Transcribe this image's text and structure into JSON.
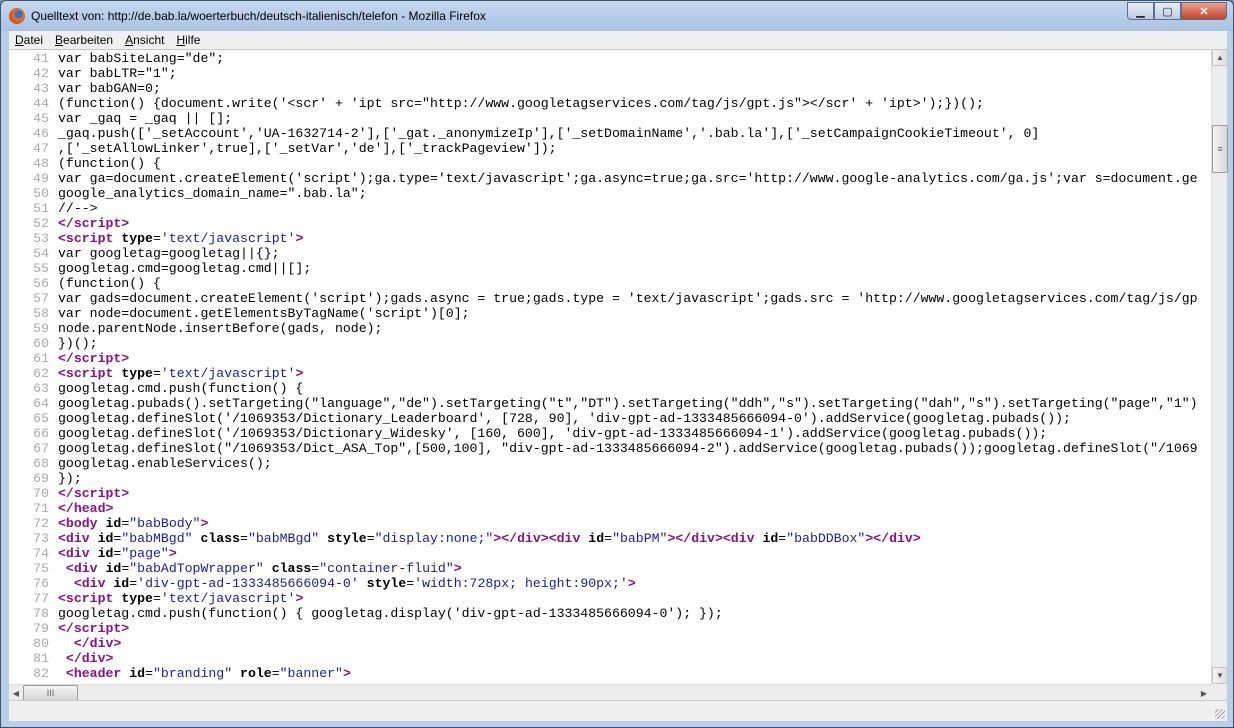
{
  "window": {
    "title": "Quelltext von: http://de.bab.la/woerterbuch/deutsch-italienisch/telefon - Mozilla Firefox",
    "controls": {
      "minimize": "▁",
      "maximize": "▢",
      "close": "✕"
    }
  },
  "menu": [
    "Datei",
    "Bearbeiten",
    "Ansicht",
    "Hilfe"
  ],
  "scroll": {
    "up": "▲",
    "down": "▼",
    "left": "◀",
    "right": "▶",
    "grip": "≡",
    "hgrip": "III"
  },
  "source": {
    "first_line": 41,
    "lines": [
      [
        [
          "x",
          "var babSiteLang=\"de\";"
        ]
      ],
      [
        [
          "x",
          "var babLTR=\"1\";"
        ]
      ],
      [
        [
          "x",
          "var babGAN=0;"
        ]
      ],
      [
        [
          "x",
          "(function() {document.write('<scr' + 'ipt src=\"http://www.googletagservices.com/tag/js/gpt.js\"></scr' + 'ipt>');})();"
        ]
      ],
      [
        [
          "x",
          "var _gaq = _gaq || [];"
        ]
      ],
      [
        [
          "x",
          "_gaq.push(['_setAccount','UA-1632714-2'],['_gat._anonymizeIp'],['_setDomainName','.bab.la'],['_setCampaignCookieTimeout', 0]"
        ]
      ],
      [
        [
          "x",
          ",['_setAllowLinker',true],['_setVar','de'],['_trackPageview']);"
        ]
      ],
      [
        [
          "x",
          "(function() {"
        ]
      ],
      [
        [
          "x",
          "var ga=document.createElement('script');ga.type='text/javascript';ga.async=true;ga.src='http://www.google-analytics.com/ga.js';var s=document.ge"
        ]
      ],
      [
        [
          "x",
          "google_analytics_domain_name=\".bab.la\";"
        ]
      ],
      [
        [
          "x",
          "//-->"
        ]
      ],
      [
        [
          "g",
          "</script>"
        ]
      ],
      [
        [
          "g",
          "<script"
        ],
        [
          "a",
          " type"
        ],
        [
          "x",
          "="
        ],
        [
          "v",
          "'text/javascript'"
        ],
        [
          "g",
          ">"
        ]
      ],
      [
        [
          "x",
          "var googletag=googletag||{};"
        ]
      ],
      [
        [
          "x",
          "googletag.cmd=googletag.cmd||[];"
        ]
      ],
      [
        [
          "x",
          "(function() {"
        ]
      ],
      [
        [
          "x",
          "var gads=document.createElement('script');gads.async = true;gads.type = 'text/javascript';gads.src = 'http://www.googletagservices.com/tag/js/gp"
        ]
      ],
      [
        [
          "x",
          "var node=document.getElementsByTagName('script')[0];"
        ]
      ],
      [
        [
          "x",
          "node.parentNode.insertBefore(gads, node);"
        ]
      ],
      [
        [
          "x",
          "})();"
        ]
      ],
      [
        [
          "g",
          "</script>"
        ]
      ],
      [
        [
          "g",
          "<script"
        ],
        [
          "a",
          " type"
        ],
        [
          "x",
          "="
        ],
        [
          "v",
          "'text/javascript'"
        ],
        [
          "g",
          ">"
        ]
      ],
      [
        [
          "x",
          "googletag.cmd.push(function() {"
        ]
      ],
      [
        [
          "x",
          "googletag.pubads().setTargeting(\"language\",\"de\").setTargeting(\"t\",\"DT\").setTargeting(\"ddh\",\"s\").setTargeting(\"dah\",\"s\").setTargeting(\"page\",\"1\")"
        ]
      ],
      [
        [
          "x",
          "googletag.defineSlot('/1069353/Dictionary_Leaderboard', [728, 90], 'div-gpt-ad-1333485666094-0').addService(googletag.pubads());"
        ]
      ],
      [
        [
          "x",
          "googletag.defineSlot('/1069353/Dictionary_Widesky', [160, 600], 'div-gpt-ad-1333485666094-1').addService(googletag.pubads());"
        ]
      ],
      [
        [
          "x",
          "googletag.defineSlot(\"/1069353/Dict_ASA_Top\",[500,100], \"div-gpt-ad-1333485666094-2\").addService(googletag.pubads());googletag.defineSlot(\"/1069"
        ]
      ],
      [
        [
          "x",
          "googletag.enableServices();"
        ]
      ],
      [
        [
          "x",
          "});"
        ]
      ],
      [
        [
          "g",
          "</script>"
        ]
      ],
      [
        [
          "g",
          "</head>"
        ]
      ],
      [
        [
          "g",
          "<body"
        ],
        [
          "a",
          " id"
        ],
        [
          "x",
          "="
        ],
        [
          "v",
          "\"babBody\""
        ],
        [
          "g",
          ">"
        ]
      ],
      [
        [
          "g",
          "<div"
        ],
        [
          "a",
          " id"
        ],
        [
          "x",
          "="
        ],
        [
          "v",
          "\"babMBgd\""
        ],
        [
          "a",
          " class"
        ],
        [
          "x",
          "="
        ],
        [
          "v",
          "\"babMBgd\""
        ],
        [
          "a",
          " style"
        ],
        [
          "x",
          "="
        ],
        [
          "v",
          "\"display:none;\""
        ],
        [
          "g",
          "></div><div"
        ],
        [
          "a",
          " id"
        ],
        [
          "x",
          "="
        ],
        [
          "v",
          "\"babPM\""
        ],
        [
          "g",
          "></div><div"
        ],
        [
          "a",
          " id"
        ],
        [
          "x",
          "="
        ],
        [
          "v",
          "\"babDDBox\""
        ],
        [
          "g",
          "></div>"
        ]
      ],
      [
        [
          "g",
          "<div"
        ],
        [
          "a",
          " id"
        ],
        [
          "x",
          "="
        ],
        [
          "v",
          "\"page\""
        ],
        [
          "g",
          ">"
        ]
      ],
      [
        [
          "x",
          " "
        ],
        [
          "g",
          "<div"
        ],
        [
          "a",
          " id"
        ],
        [
          "x",
          "="
        ],
        [
          "v",
          "\"babAdTopWrapper\""
        ],
        [
          "a",
          " class"
        ],
        [
          "x",
          "="
        ],
        [
          "v",
          "\"container-fluid\""
        ],
        [
          "g",
          ">"
        ]
      ],
      [
        [
          "x",
          "  "
        ],
        [
          "g",
          "<div"
        ],
        [
          "a",
          " id"
        ],
        [
          "x",
          "="
        ],
        [
          "v",
          "'div-gpt-ad-1333485666094-0'"
        ],
        [
          "a",
          " style"
        ],
        [
          "x",
          "="
        ],
        [
          "v",
          "'width:728px; height:90px;'"
        ],
        [
          "g",
          ">"
        ]
      ],
      [
        [
          "g",
          "<script"
        ],
        [
          "a",
          " type"
        ],
        [
          "x",
          "="
        ],
        [
          "v",
          "'text/javascript'"
        ],
        [
          "g",
          ">"
        ]
      ],
      [
        [
          "x",
          "googletag.cmd.push(function() { googletag.display('div-gpt-ad-1333485666094-0'); });"
        ]
      ],
      [
        [
          "g",
          "</script>"
        ]
      ],
      [
        [
          "x",
          "  "
        ],
        [
          "g",
          "</div>"
        ]
      ],
      [
        [
          "x",
          " "
        ],
        [
          "g",
          "</div>"
        ]
      ],
      [
        [
          "x",
          " "
        ],
        [
          "g",
          "<header"
        ],
        [
          "a",
          " id"
        ],
        [
          "x",
          "="
        ],
        [
          "v",
          "\"branding\""
        ],
        [
          "a",
          " role"
        ],
        [
          "x",
          "="
        ],
        [
          "v",
          "\"banner\""
        ],
        [
          "g",
          ">"
        ]
      ]
    ]
  }
}
